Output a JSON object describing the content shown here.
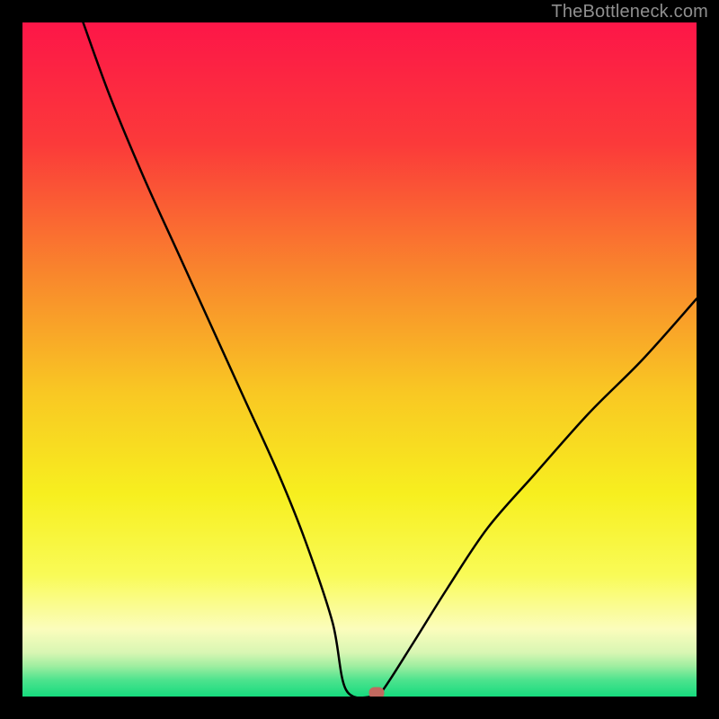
{
  "watermark": "TheBottleneck.com",
  "colors": {
    "frame": "#000000",
    "watermark": "#8f8f8f",
    "curve": "#000000",
    "marker": "#c1695f",
    "gradient_stops": [
      {
        "offset": 0.0,
        "color": "#fd1648"
      },
      {
        "offset": 0.18,
        "color": "#fb3a3a"
      },
      {
        "offset": 0.38,
        "color": "#f9892c"
      },
      {
        "offset": 0.55,
        "color": "#f9c823"
      },
      {
        "offset": 0.7,
        "color": "#f7ef1f"
      },
      {
        "offset": 0.82,
        "color": "#f9fb57"
      },
      {
        "offset": 0.9,
        "color": "#fbfdbc"
      },
      {
        "offset": 0.935,
        "color": "#d8f6b3"
      },
      {
        "offset": 0.955,
        "color": "#9eeea0"
      },
      {
        "offset": 0.975,
        "color": "#4fe38e"
      },
      {
        "offset": 1.0,
        "color": "#16db7e"
      }
    ]
  },
  "chart_data": {
    "type": "line",
    "title": "",
    "xlabel": "",
    "ylabel": "",
    "xlim": [
      0,
      100
    ],
    "ylim": [
      0,
      100
    ],
    "legend": false,
    "grid": false,
    "notes": "Bottleneck-style V curve. x≈relative component score, y≈bottleneck %. Minimum near x≈52 with a short flat segment ~x 48–52 at y≈0. Left branch reaches y=100 at x≈9; right branch reaches y≈59 at x=100. Background is a vertical heat gradient (red top → green bottom). Axes are unlabeled/implicit.",
    "series": [
      {
        "name": "bottleneck-curve",
        "x": [
          9,
          13,
          18,
          23,
          28,
          33,
          38,
          42,
          46,
          48,
          52,
          53.5,
          58,
          63,
          69,
          76,
          84,
          92,
          100
        ],
        "values": [
          100,
          89,
          77,
          66,
          55,
          44,
          33,
          23,
          11,
          1,
          0,
          1,
          8,
          16,
          25,
          33,
          42,
          50,
          59
        ]
      }
    ],
    "marker": {
      "x": 52.5,
      "y": 0.5,
      "color": "#c1695f"
    }
  }
}
